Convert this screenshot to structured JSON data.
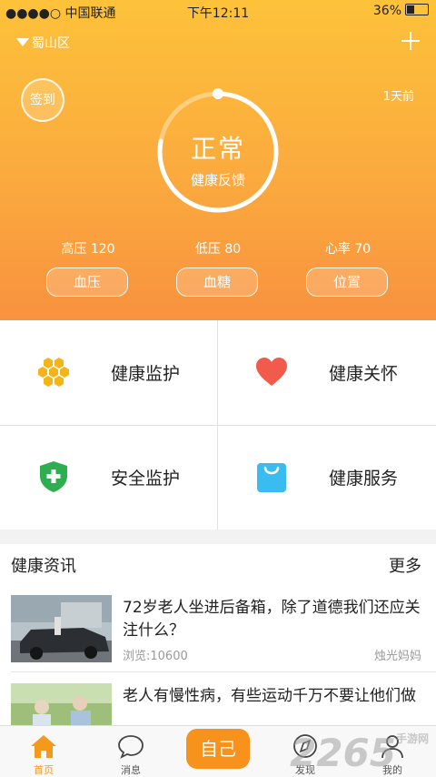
{
  "status_bar": {
    "carrier": "●●●●○ 中国联通",
    "time": "下午12:11",
    "battery": "36%"
  },
  "header": {
    "location": "蜀山区",
    "checkin_label": "签到",
    "updated": "1天前",
    "ring": {
      "status": "正常",
      "caption": "健康反馈",
      "progress": 0.78
    },
    "metrics": [
      {
        "label": "高压",
        "value": "120"
      },
      {
        "label": "低压",
        "value": "80"
      },
      {
        "label": "心率",
        "value": "70"
      }
    ],
    "buttons": [
      "血压",
      "血糖",
      "位置"
    ]
  },
  "features": [
    {
      "label": "健康监护",
      "icon": "honeycomb-icon",
      "color": "#f5b417"
    },
    {
      "label": "健康关怀",
      "icon": "heart-icon",
      "color": "#f25b4b"
    },
    {
      "label": "安全监护",
      "icon": "shield-plus-icon",
      "color": "#2fae4f"
    },
    {
      "label": "健康服务",
      "icon": "shopping-bag-icon",
      "color": "#3bbcf0"
    }
  ],
  "news": {
    "heading": "健康资讯",
    "more": "更多",
    "items": [
      {
        "title": "72岁老人坐进后备箱，除了道德我们还应关注什么？",
        "views": "浏览:10600",
        "author": "烛光妈妈"
      },
      {
        "title": "老人有慢性病，有些运动千万不要让他们做",
        "views": "",
        "author": ""
      }
    ]
  },
  "tabbar": {
    "tabs": [
      {
        "label": "首页",
        "icon": "home-icon",
        "active": true
      },
      {
        "label": "消息",
        "icon": "chat-bubble-icon",
        "active": false
      },
      {
        "label": "发现",
        "icon": "compass-icon",
        "active": false
      },
      {
        "label": "我的",
        "icon": "person-icon",
        "active": false
      }
    ],
    "center_label": "自己"
  },
  "watermark": {
    "text": "2265",
    "sub": "手游网"
  }
}
